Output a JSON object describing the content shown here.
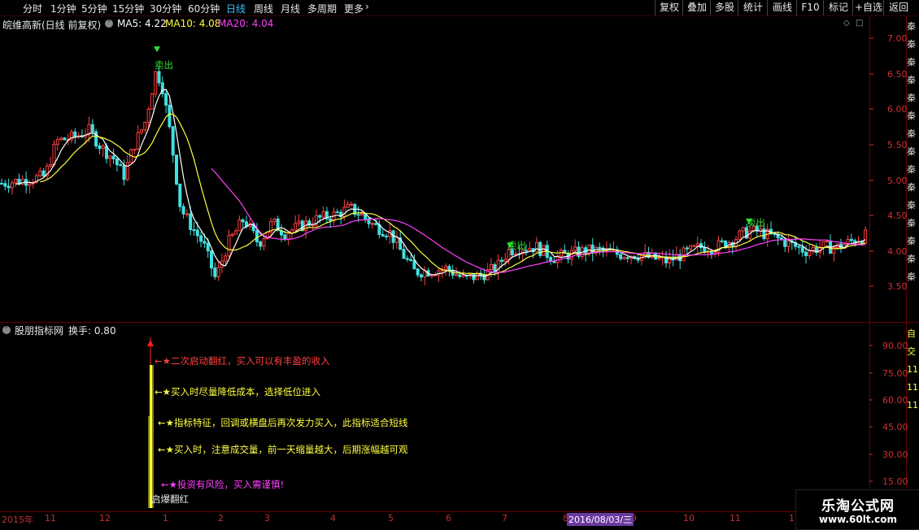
{
  "toolbar": {
    "periods": [
      "分时",
      "1分钟",
      "5分钟",
      "15分钟",
      "30分钟",
      "60分钟",
      "日线",
      "周线",
      "月线",
      "多周期",
      "更多"
    ],
    "active": "日线",
    "right_buttons": [
      "复权",
      "叠加",
      "多股",
      "统计",
      "画线",
      "F10",
      "标记",
      "+自选",
      "返回"
    ]
  },
  "header": {
    "stock_name": "皖维高新(日线 前复权)",
    "ma5_label": "MA5: 4.22",
    "ma10_label": "MA10: 4.08",
    "ma20_label": "MA20: 4.04"
  },
  "colors": {
    "up": "#ff4040",
    "down": "#40e0e0",
    "ma5": "#ffffff",
    "ma10": "#ffff40",
    "ma20": "#ff40ff",
    "axis": "#d03030",
    "sell_marker": "#30e030"
  },
  "price_axis": {
    "ticks": [
      "7.00",
      "6.50",
      "6.00",
      "5.50",
      "5.00",
      "4.50",
      "4.00",
      "3.50"
    ]
  },
  "sell_signals": [
    "卖出",
    "卖出",
    "卖出"
  ],
  "indicator": {
    "title": "股朋指标网",
    "turnover": "换手: 0.80",
    "ticks": [
      "90.00",
      "75.00",
      "60.00",
      "45.00",
      "30.00",
      "15.00"
    ],
    "annotations": [
      {
        "text": "←★二次启动翻红，买入可以有丰盈的收入",
        "color": "#ff4040"
      },
      {
        "text": "←★买入时尽量降低成本，选择低位进入",
        "color": "#ffff40"
      },
      {
        "text": "←★指标特征，回调或横盘后再次发力买入，此指标适合短线",
        "color": "#ffff40"
      },
      {
        "text": "←★买入时，注意成交量，前一天缩量越大，后期涨幅越可观",
        "color": "#ffff40"
      },
      {
        "text": "←★投资有风险，买入需谨慎!",
        "color": "#ff40ff"
      }
    ],
    "bar_label": "启爆翻红"
  },
  "x_axis": {
    "labels": [
      "2015年",
      "11",
      "12",
      "1",
      "2",
      "3",
      "4",
      "5",
      "6",
      "7",
      "8",
      "9",
      "10",
      "11",
      "1"
    ],
    "cursor_date": "2016/08/03/三"
  },
  "right_side_text": {
    "top": "秦秦秦秦秦秦秦秦秦秦秦秦秦秦秦",
    "bottom": "自交111111"
  },
  "watermark": {
    "site_name": "乐淘公式网",
    "url": "www.60lt.com"
  }
}
